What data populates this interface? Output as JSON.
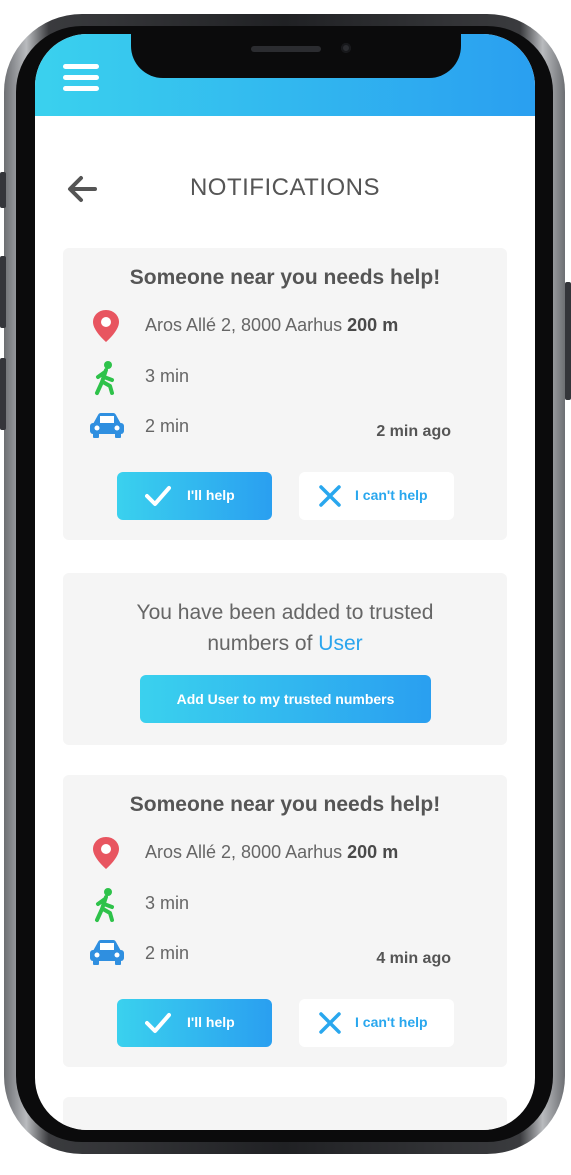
{
  "header": {
    "title": "NOTIFICATIONS"
  },
  "colors": {
    "accent_start": "#3ad1ee",
    "accent_end": "#2a9ff0",
    "pin_red": "#e85560",
    "walk_green": "#2ec24a",
    "car_blue": "#2f8fe0"
  },
  "notifications": [
    {
      "title": "Someone near you needs help!",
      "address": "Aros Allé 2, 8000 Aarhus",
      "distance": "200 m",
      "walk_time": "3 min",
      "drive_time": "2 min",
      "ago": "2 min ago",
      "help_label": "I'll help",
      "cant_label": "I can't help"
    },
    {
      "title": "Someone near you needs help!",
      "address": "Aros Allé 2, 8000 Aarhus",
      "distance": "200 m",
      "walk_time": "3 min",
      "drive_time": "2 min",
      "ago": "4 min ago",
      "help_label": "I'll help",
      "cant_label": "I can't help"
    }
  ],
  "trusted": {
    "text_line1": "You have been added to trusted",
    "text_line2": "numbers of",
    "user_name": "User",
    "button_label": "Add User to my trusted numbers"
  },
  "icons": [
    "menu-icon",
    "back-arrow-icon",
    "location-pin-icon",
    "walking-icon",
    "car-icon",
    "check-icon",
    "close-icon"
  ]
}
